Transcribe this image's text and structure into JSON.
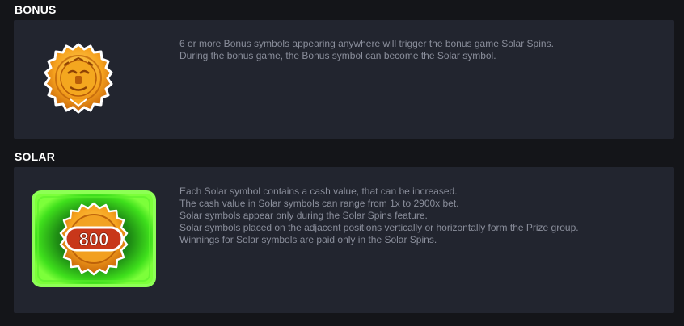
{
  "sections": {
    "bonus": {
      "title": "BONUS",
      "lines": [
        "6 or more Bonus symbols appearing anywhere will trigger the bonus game Solar Spins.",
        "During the bonus game, the Bonus symbol can become the Solar symbol."
      ],
      "icon": "sun-medallion-icon"
    },
    "solar": {
      "title": "SOLAR",
      "value_label": "800",
      "lines": [
        "Each Solar symbol contains a cash value, that can be increased.",
        "The cash value in Solar symbols can range from 1x to 2900x bet.",
        "Solar symbols appear only during the Solar Spins feature.",
        "Solar symbols placed on the adjacent positions vertically or horizontally form the Prize group.",
        "Winnings for Solar symbols are paid only in the Solar Spins."
      ],
      "icon": "solar-symbol-icon"
    }
  },
  "colors": {
    "background": "#141519",
    "card": "#22252f",
    "text": "#8a8e9b",
    "title": "#ffffff",
    "gold": "#f6a21e",
    "glow": "#3fe01c"
  }
}
